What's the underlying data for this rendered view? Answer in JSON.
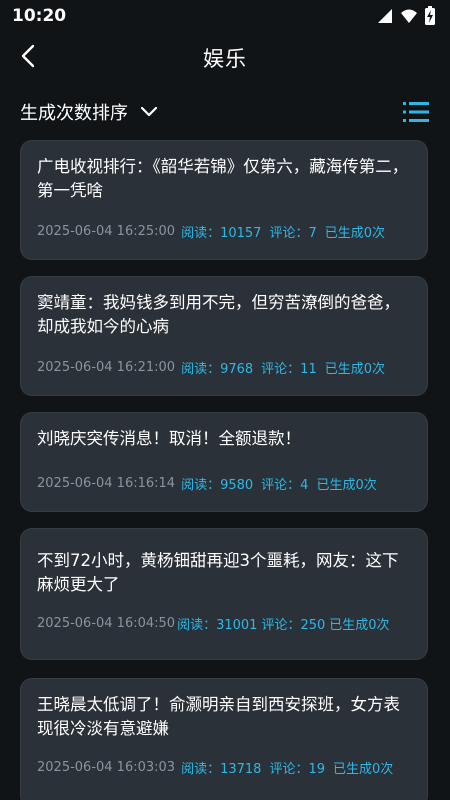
{
  "status_bar": {
    "time": "10:20"
  },
  "header": {
    "title": "娱乐"
  },
  "sort": {
    "label": "生成次数排序"
  },
  "articles": [
    {
      "title": "广电收视排行：《韶华若锦》仅第六，藏海传第二，第一凭啥",
      "time": "2025-06-04 16:25:00",
      "read": "阅读：10157",
      "comment": "评论：7",
      "generated": "已生成0次"
    },
    {
      "title": "窦靖童：我妈钱多到用不完，但穷苦潦倒的爸爸，却成我如今的心病",
      "time": "2025-06-04 16:21:00",
      "read": "阅读：9768",
      "comment": "评论：11",
      "generated": "已生成0次"
    },
    {
      "title": "刘晓庆突传消息！取消！全额退款！",
      "time": "2025-06-04 16:16:14",
      "read": "阅读：9580",
      "comment": "评论：4",
      "generated": "已生成0次"
    },
    {
      "title": "不到72小时，黄杨钿甜再迎3个噩耗，网友：这下麻烦更大了",
      "time": "2025-06-04 16:04:50",
      "read": "阅读：31001",
      "comment": "评论：250",
      "generated": "已生成0次"
    },
    {
      "title": "王晓晨太低调了！俞灏明亲自到西安探班，女方表现很冷淡有意避嫌",
      "time": "2025-06-04 16:03:03",
      "read": "阅读：13718",
      "comment": "评论：19",
      "generated": "已生成0次"
    }
  ]
}
